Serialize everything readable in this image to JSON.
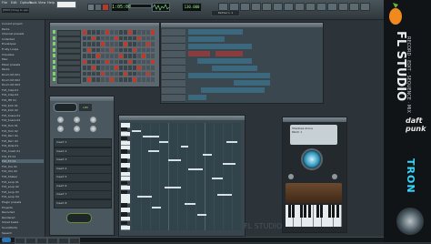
{
  "menu": [
    "File",
    "Edit",
    "Options",
    "Tools",
    "View",
    "Help"
  ],
  "song_position": "1:05:000",
  "hint_text": "[HINT] Drag to pan",
  "pattern_label": "Pattern 1",
  "tempo": "130.000",
  "browser": {
    "items": [
      "Current project",
      "Packs",
      "Channel presets",
      "Collected",
      "Envelopes",
      "Fruity Loops",
      "Impulses",
      "Misc",
      "Mixer presets",
      "Packs",
      "Drum Kit 001",
      "Drum Kit 002",
      "Drum Kit 003",
      "FL5_Clap 01",
      "FL5_Clap 02",
      "FL5_HH 01",
      "FL5_Kick 01",
      "FL5_Kick 02",
      "FL5_Snare 01",
      "FL5_Snare 02",
      "FL5_Tom 01",
      "FL5_Tom 02",
      "FL5_Perc 01",
      "FL5_Perc 02",
      "FL5_Ride 01",
      "FL5_Crash 01",
      "FL5_FX 01",
      "FL5_FX 02",
      "FL5_Vox 01",
      "FL5_Vox 02",
      "FL5_Shaker",
      "FL5_Loop 01",
      "FL5_Loop 02",
      "FL5_Loop 03",
      "FL5_Loop 04",
      "Plugin presets",
      "Projects",
      "Recorded",
      "Rendered",
      "Sliced beats",
      "Soundfonts",
      "Speech"
    ],
    "selected_index": 27
  },
  "mixer": {
    "title": "Fruity Limiter",
    "slots": [
      "Insert 1",
      "Insert 2",
      "Insert 3",
      "Insert 4",
      "Insert 5",
      "Insert 6",
      "Insert 7",
      "Insert 8"
    ]
  },
  "plugin": {
    "name": "Shadows drone",
    "preset": "Patch 1"
  },
  "watermark": "FL STUDIO",
  "brand": {
    "title": "FL STUDIO",
    "tagline": "RECORD · EDIT · SEQUENCE · MIX",
    "artist": "daft punk",
    "film": "TRON"
  },
  "colors": {
    "accent_orange": "#f08a1d",
    "lcd_green": "#9ef08b",
    "step_red": "#c0392b",
    "step_off": "#3a4348",
    "block_blue": "#3d6f86",
    "block_red": "#9a3c3c"
  }
}
